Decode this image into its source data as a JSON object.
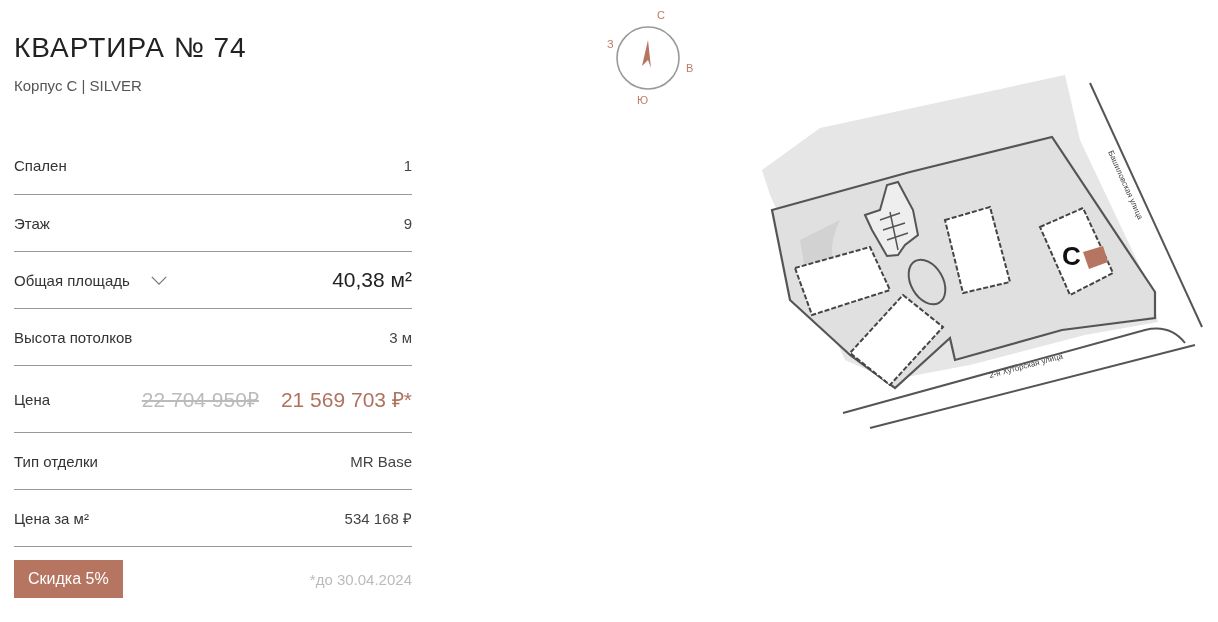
{
  "title": "КВАРТИРА № 74",
  "subtitle": "Корпус С | SILVER",
  "rows": [
    {
      "kind": "text",
      "label": "Спален",
      "value": "1"
    },
    {
      "kind": "text",
      "label": "Этаж",
      "value": "9"
    },
    {
      "kind": "dropdown",
      "label": "Общая площадь",
      "value": "40,38 м²"
    },
    {
      "kind": "text",
      "label": "Высота потолков",
      "value": "3 м"
    },
    {
      "kind": "price",
      "label": "Цена",
      "old_value": "22 704 950₽",
      "value": "21 569 703 ₽*"
    },
    {
      "kind": "text",
      "label": "Тип отделки",
      "value": "MR Base"
    },
    {
      "kind": "text",
      "label": "Цена за м²",
      "value": "534 168 ₽"
    }
  ],
  "discount_button": "Скидка 5%",
  "discount_note": "*до 30.04.2024",
  "compass": {
    "north": "С",
    "east": "В",
    "south": "Ю",
    "west": "З"
  },
  "site_plan": {
    "building_label": "С",
    "streets": [
      {
        "kind": "east",
        "name": "Башиловская улица"
      },
      {
        "kind": "south",
        "name": "2-я Хуторская улица"
      }
    ]
  }
}
